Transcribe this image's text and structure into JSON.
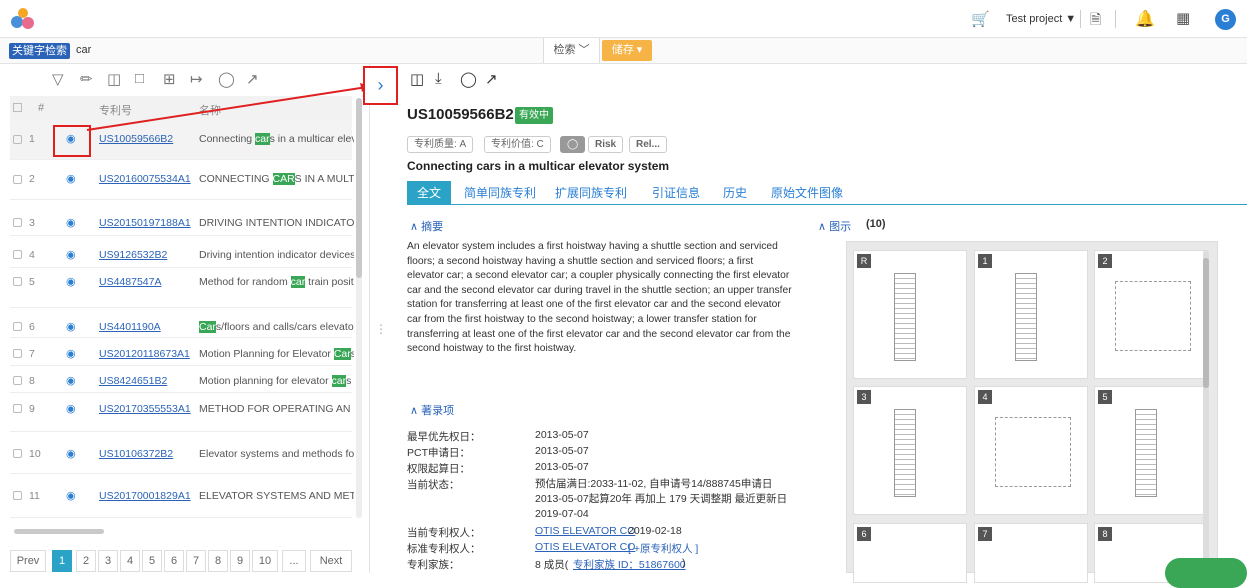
{
  "header": {
    "project": "Test project ▼",
    "avatar": "G",
    "icons": [
      "cart-icon",
      "document-icon",
      "bell-icon",
      "grid-icon"
    ]
  },
  "search": {
    "tag": "关键字检索",
    "query": "car",
    "search_label": "检索 ﹀",
    "save_label": "储存 ▾"
  },
  "list": {
    "headers": {
      "num": "#",
      "patent": "专利号",
      "name": "名称"
    },
    "rows": [
      {
        "n": "1",
        "pn": "US10059566B2",
        "title": "Connecting cars in a multicar eleva"
      },
      {
        "n": "2",
        "pn": "US20160075534A1",
        "title": "CONNECTING CARS IN A MULTIC"
      },
      {
        "n": "3",
        "pn": "US20150197188A1",
        "title": "DRIVING INTENTION INDICATOR I"
      },
      {
        "n": "4",
        "pn": "US9126532B2",
        "title": "Driving intention indicator devices"
      },
      {
        "n": "5",
        "pn": "US4487547A",
        "title": "Method for random car train posit"
      },
      {
        "n": "6",
        "pn": "US4401190A",
        "title": "Cars/floors and calls/cars elevator"
      },
      {
        "n": "7",
        "pn": "US20120118673A1",
        "title": "Motion Planning for Elevator Cars"
      },
      {
        "n": "8",
        "pn": "US8424651B2",
        "title": "Motion planning for elevator cars i"
      },
      {
        "n": "9",
        "pn": "US20170355553A1",
        "title": "METHOD FOR OPERATING AN ELE"
      },
      {
        "n": "10",
        "pn": "US10106372B2",
        "title": "Elevator systems and methods for"
      },
      {
        "n": "11",
        "pn": "US20170001829A1",
        "title": "ELEVATOR SYSTEMS AND METHOI"
      }
    ],
    "pager": [
      "Prev",
      "1",
      "2",
      "3",
      "4",
      "5",
      "6",
      "7",
      "8",
      "9",
      "10",
      "...",
      "Next"
    ]
  },
  "detail": {
    "patent_number": "US10059566B2",
    "status": "有效中",
    "quality": "专利质量: A",
    "value": "专利价值: C",
    "risk": "Risk",
    "rel": "Rel...",
    "title": "Connecting cars in a multicar elevator system",
    "tabs": [
      "全文",
      "简单同族专利",
      "扩展同族专利",
      "引证信息",
      "历史",
      "原始文件图像"
    ],
    "abstract_heading": "∧ 摘要",
    "figures_heading": "∧ 图示",
    "figures_count": "(10)",
    "abstract": "An elevator system includes a first hoistway having a shuttle section and serviced floors; a second hoistway having a shuttle section and serviced floors; a first elevator car; a second elevator car; a coupler physically connecting the first elevator car and the second elevator car during travel in the shuttle section; an upper transfer station for transferring at least one of the first elevator car and the second elevator car from the first hoistway to the second hoistway; a lower transfer station for transferring at least one of the first elevator car and the second elevator car from the second hoistway to the first hoistway.",
    "biblio_heading": "∧ 著录项",
    "biblio": [
      {
        "label": "最早优先权日：",
        "value": "2013-05-07"
      },
      {
        "label": "PCT申请日：",
        "value": "2013-05-07"
      },
      {
        "label": "权限起算日：",
        "value": "2013-05-07"
      },
      {
        "label": "当前状态：",
        "value": "预估届满日:2033-11-02, 自申请号14/888745申请日2013-05-07起算20年 再加上 179 天调整期  最近更新日 2019-07-04"
      },
      {
        "label": "当前专利权人：",
        "value": "OTIS ELEVATOR CO",
        "extra": "2019-02-18"
      },
      {
        "label": "标准专利权人：",
        "value": "OTIS ELEVATOR CO",
        "extra": "[ +原专利权人 ]"
      },
      {
        "label": "专利家族：",
        "value": "8 成员(",
        "link": "专利家族 ID：51867600",
        "close": ")"
      }
    ],
    "thumbs": [
      "R",
      "1",
      "2",
      "3",
      "4",
      "5",
      "6",
      "7",
      "8"
    ]
  }
}
